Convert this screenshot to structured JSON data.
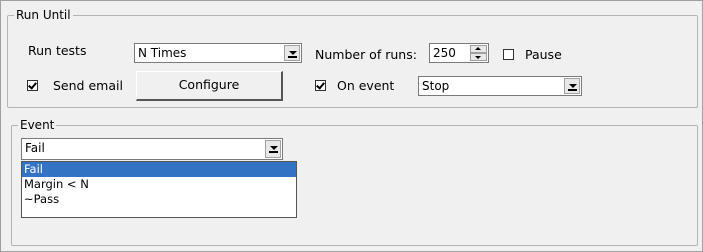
{
  "run_until": {
    "title": "Run Until",
    "run_tests_label": "Run tests",
    "run_tests_value": "N Times",
    "num_runs_label": "Number of runs:",
    "num_runs_value": "250",
    "pause_label": "Pause",
    "pause_checked": false,
    "send_email_label": "Send email",
    "send_email_checked": true,
    "configure_label": "Configure",
    "on_event_label": "On event",
    "on_event_checked": true,
    "on_event_value": "Stop"
  },
  "event": {
    "title": "Event",
    "selected_value": "Fail",
    "options": [
      {
        "label": "Fail",
        "selected": true
      },
      {
        "label": "Margin < N",
        "selected": false
      },
      {
        "label": "~Pass",
        "selected": false
      }
    ]
  },
  "colors": {
    "background": "#f0f0f0",
    "selection": "#3373c4"
  },
  "icons": {
    "dropdown": "chevron-down-icon",
    "spin_up": "spin-up-icon",
    "spin_down": "spin-down-icon",
    "check": "check-icon"
  }
}
